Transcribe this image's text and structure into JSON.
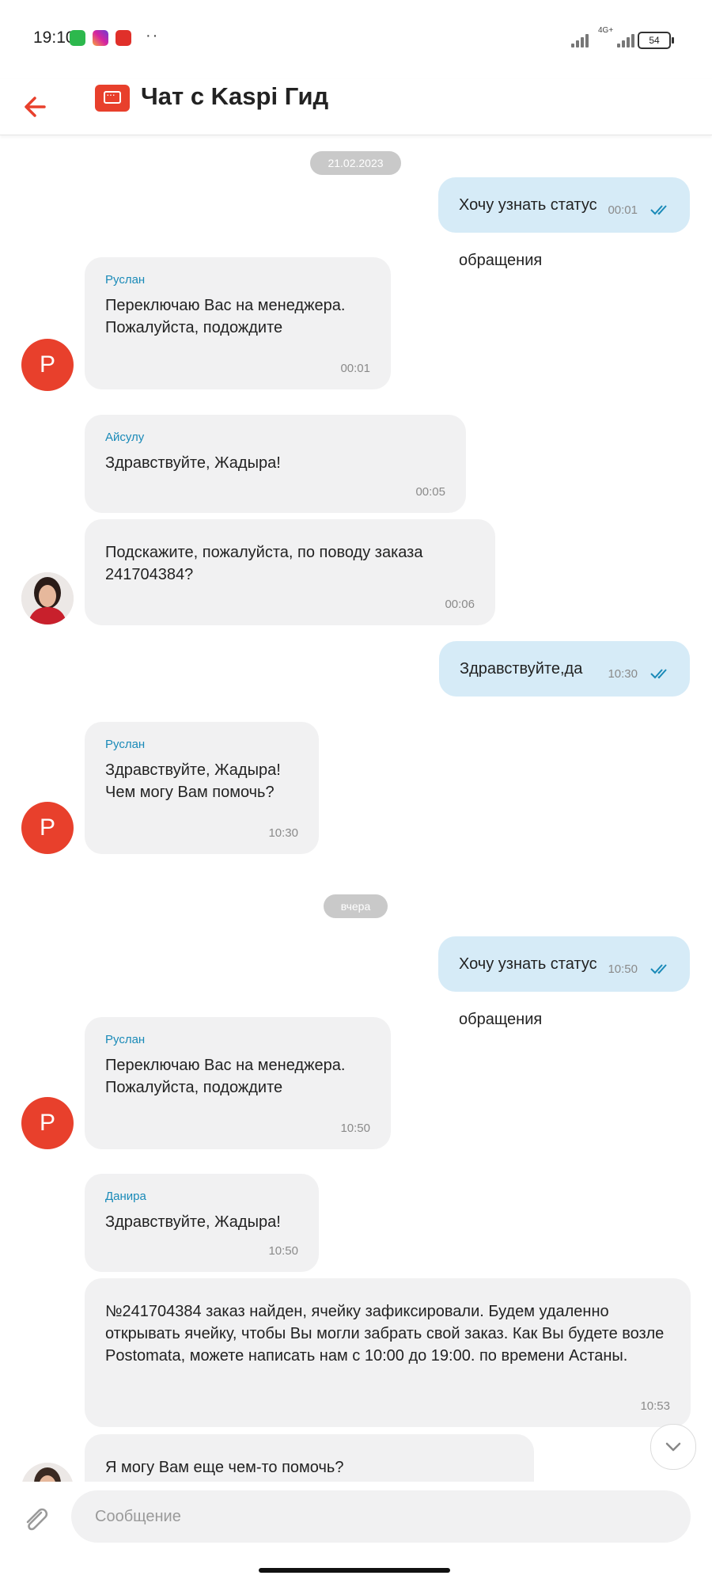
{
  "status_bar": {
    "time": "19:10",
    "network_label": "4G+",
    "battery": "54",
    "app_icons": [
      {
        "name": "phone-app-icon",
        "color": "#2db84d"
      },
      {
        "name": "instagram-app-icon",
        "color": "#d6249f"
      },
      {
        "name": "youtube-app-icon",
        "color": "#e0302a"
      }
    ]
  },
  "header": {
    "back_icon": "arrow-left-icon",
    "logo_icon": "chat-bubble-icon",
    "title": "Чат с Kaspi Гид",
    "accent_color": "#e8402c"
  },
  "messages": [
    {
      "type": "date",
      "text": "21.02.2023"
    },
    {
      "type": "out",
      "text": "Хочу узнать статус обращения",
      "time": "00:01",
      "read": true
    },
    {
      "type": "in",
      "sender": "Руслан",
      "text": "Переключаю Вас на менеджера.\nПожалуйста, подождите",
      "time": "00:01",
      "avatar": "Р"
    },
    {
      "type": "in",
      "sender": "Айсулу",
      "text": "Здравствуйте, Жадыра!",
      "time": "00:05"
    },
    {
      "type": "in",
      "text": "Подскажите, пожалуйста, по поводу заказа 241704384?",
      "time": "00:06",
      "avatar": "photo"
    },
    {
      "type": "out",
      "text": "Здравствуйте,да",
      "time": "10:30",
      "read": true
    },
    {
      "type": "in",
      "sender": "Руслан",
      "text": "Здравствуйте, Жадыра!\nЧем могу Вам помочь?",
      "time": "10:30",
      "avatar": "Р"
    },
    {
      "type": "date",
      "text": "вчера"
    },
    {
      "type": "out",
      "text": "Хочу узнать статус обращения",
      "time": "10:50",
      "read": true
    },
    {
      "type": "in",
      "sender": "Руслан",
      "text": "Переключаю Вас на менеджера.\nПожалуйста, подождите",
      "time": "10:50",
      "avatar": "Р"
    },
    {
      "type": "in",
      "sender": "Данира",
      "text": "Здравствуйте, Жадыра!",
      "time": "10:50"
    },
    {
      "type": "in",
      "text": "№241704384 заказ найден, ячейку зафиксировали. Будем удаленно открывать ячейку, чтобы Вы могли забрать свой заказ. Как Вы будете возле Postomata, можете написать нам с 10:00 до 19:00. по времени Астаны.",
      "time": "10:53"
    },
    {
      "type": "in",
      "text": "Я могу Вам еще чем-то помочь?",
      "time": "",
      "avatar": "photo"
    }
  ],
  "input": {
    "placeholder": "Сообщение",
    "attach_icon": "paperclip-icon",
    "scroll_icon": "chevron-down-icon"
  },
  "colors": {
    "outgoing_bubble": "#d6ebf7",
    "incoming_bubble": "#f1f1f2",
    "sender_name": "#1a8ab8",
    "avatar_bg": "#e8402c",
    "read_check": "#1a8ab8"
  }
}
